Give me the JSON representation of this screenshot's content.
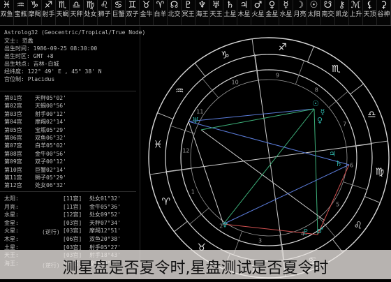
{
  "signbar": [
    {
      "glyph": "♓",
      "label": "双鱼"
    },
    {
      "glyph": "♒",
      "label": "宝瓶"
    },
    {
      "glyph": "♑",
      "label": "摩羯"
    },
    {
      "glyph": "♐",
      "label": "射手"
    },
    {
      "glyph": "♏",
      "label": "天蝎"
    },
    {
      "glyph": "♎",
      "label": "天秤"
    },
    {
      "glyph": "♍",
      "label": "处女"
    },
    {
      "glyph": "♌",
      "label": "狮子"
    },
    {
      "glyph": "♋",
      "label": "巨蟹"
    },
    {
      "glyph": "♊",
      "label": "双子"
    },
    {
      "glyph": "♉",
      "label": "金牛"
    },
    {
      "glyph": "♈",
      "label": "白羊"
    },
    {
      "glyph": "☊",
      "label": "北交"
    },
    {
      "glyph": "♇",
      "label": "冥王"
    },
    {
      "glyph": "♆",
      "label": "海王"
    },
    {
      "glyph": "♅",
      "label": "天王"
    },
    {
      "glyph": "♄",
      "label": "土星"
    },
    {
      "glyph": "♃",
      "label": "木星"
    },
    {
      "glyph": "♂",
      "label": "火星"
    },
    {
      "glyph": "♀",
      "label": "金星"
    },
    {
      "glyph": "☿",
      "label": "水星"
    },
    {
      "glyph": "☽",
      "label": "月亮"
    },
    {
      "glyph": "☉",
      "label": "太阳"
    },
    {
      "glyph": "☋",
      "label": "南交"
    },
    {
      "glyph": "⚷",
      "label": "凯龙"
    },
    {
      "glyph": "ℳ",
      "label": "上升"
    },
    {
      "glyph": "⚸",
      "label": "天顶"
    },
    {
      "glyph": "⚳",
      "label": "谷神"
    }
  ],
  "panel": {
    "header": "Astrolog32 (Geocentric/Tropical/True Node)",
    "info": [
      "文士: 范蠡",
      "出生时间: 1986-09-25 08:30:00",
      "出生时区: GMT +8",
      "出生地点: 吉林-白城",
      "经纬度: 122° 49' E , 45° 38' N",
      "宫位制: Placidus"
    ],
    "houses": [
      {
        "n": "第01宫",
        "v": "天秤05°02'"
      },
      {
        "n": "第02宫",
        "v": "天蝎00°56'"
      },
      {
        "n": "第03宫",
        "v": "射手00°12'"
      },
      {
        "n": "第04宫",
        "v": "摩羯02°14'"
      },
      {
        "n": "第05宫",
        "v": "宝瓶05°29'"
      },
      {
        "n": "第06宫",
        "v": "双鱼06°32'"
      },
      {
        "n": "第07宫",
        "v": "白羊05°02'"
      },
      {
        "n": "第08宫",
        "v": "金牛00°56'"
      },
      {
        "n": "第09宫",
        "v": "双子00°12'"
      },
      {
        "n": "第10宫",
        "v": "巨蟹02°14'"
      },
      {
        "n": "第11宫",
        "v": "狮子05°29'"
      },
      {
        "n": "第12宫",
        "v": "处女06°32'"
      }
    ],
    "planets": [
      {
        "n": "太阳:",
        "h": "[11宫]",
        "v": "处女01°32'"
      },
      {
        "n": "月亮:",
        "h": "[11宫]",
        "v": "金牛05°36'"
      },
      {
        "n": "水星:",
        "h": "[12宫]",
        "v": "处女09°52'"
      },
      {
        "n": "金星:",
        "h": "[03宫]",
        "v": "天秤07°34'"
      },
      {
        "n": "火星:",
        "h": "[03宫]",
        "v": "摩羯12°51'"
      },
      {
        "n": "木星:",
        "h": "[06宫]",
        "v": "双鱼20°38'"
      },
      {
        "n": "土星:",
        "h": "[03宫]",
        "v": "射手05°27'"
      },
      {
        "n": "天王:",
        "h": "[03宫]",
        "v": "射手18°43'"
      },
      {
        "n": "海王:",
        "h": "[03宫]",
        "v": "摩羯03°35'"
      }
    ],
    "retro": [
      "(逆行)",
      "(逆行)"
    ]
  },
  "chart": {
    "house_numbers": [
      "1",
      "2",
      "3",
      "4",
      "5",
      "6",
      "7",
      "8",
      "9",
      "10",
      "11",
      "12"
    ],
    "sign_glyphs": [
      "♈",
      "♉",
      "♊",
      "♋",
      "♌",
      "♍",
      "♎",
      "♏",
      "♐",
      "♑",
      "♒",
      "♓"
    ]
  },
  "caption": "测星盘是否夏令时,星盘测试是否夏令时"
}
